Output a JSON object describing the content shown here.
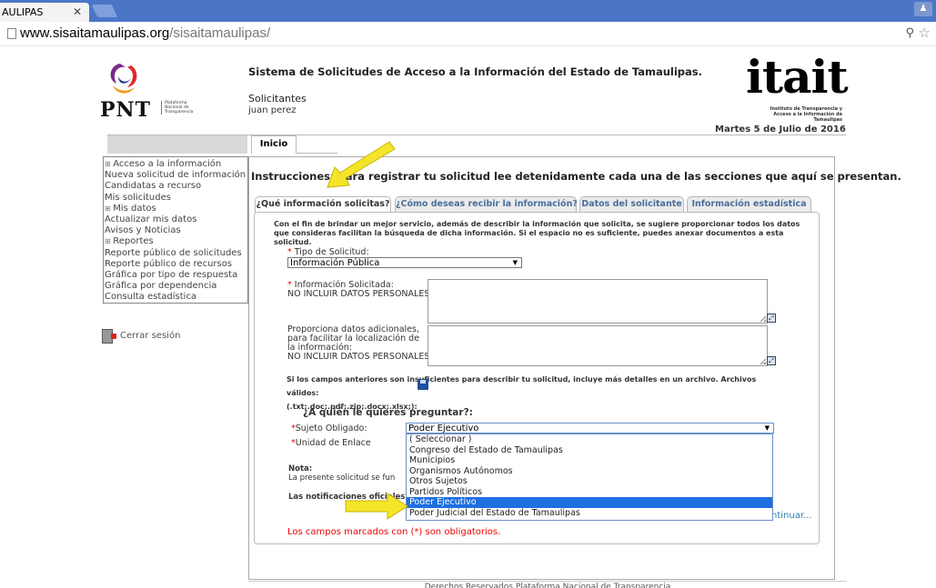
{
  "browser": {
    "tab_title": "AULIPAS",
    "tab_close": "✕",
    "url_host": "www.sisaitamaulipas.org",
    "url_path": "/sisaitamaulipas/"
  },
  "header": {
    "pnt_logo": "PNT",
    "pnt_subtitle": "Plataforma Nacional de Transparencia",
    "system_title": "Sistema de Solicitudes de Acceso a la Información del Estado de Tamaulipas.",
    "role": "Solicitantes",
    "user": "juan perez",
    "itait_logo": "itait",
    "itait_subtitle": "Instituto de Transparencia y Acceso a la Información de Tamaulipas",
    "date": "Martes 5 de Julio de 2016",
    "home_tab": "Inicio"
  },
  "sidebar": {
    "items": [
      {
        "label": "Acceso a la información",
        "section": true
      },
      {
        "label": "Nueva solicitud de información",
        "section": false
      },
      {
        "label": "Candidatas a recurso",
        "section": false
      },
      {
        "label": "Mis solicitudes",
        "section": false
      },
      {
        "label": "Mis datos",
        "section": true
      },
      {
        "label": "Actualizar mis datos",
        "section": false
      },
      {
        "label": "Avisos y Noticias",
        "section": false
      },
      {
        "label": "Reportes",
        "section": true
      },
      {
        "label": "Reporte público de solicitudes",
        "section": false
      },
      {
        "label": "Reporte público de recursos",
        "section": false
      },
      {
        "label": "Gráfica por tipo de respuesta",
        "section": false
      },
      {
        "label": "Gráfica por dependencia",
        "section": false
      },
      {
        "label": "Consulta estadística",
        "section": false
      }
    ],
    "logout": "Cerrar sesión"
  },
  "main": {
    "instructions": "Instrucciones: Para registrar tu solicitud lee detenidamente cada una de las secciones que aquí se presentan.",
    "tabs": [
      {
        "label": "¿Qué información solicitas?",
        "active": true
      },
      {
        "label": "¿Cómo deseas recibir la información?",
        "active": false
      },
      {
        "label": "Datos del solicitante",
        "active": false
      },
      {
        "label": "Información estadística",
        "active": false
      }
    ],
    "intro": "Con el fin de brindar un mejor servicio, además de describir la información que solicita, se sugiere proporcionar todos los datos que consideras facilitan la búsqueda de dicha información. Si el espacio no es suficiente, puedes anexar documentos a esta solicitud.",
    "tipo_label": "Tipo de Solicitud:",
    "tipo_value": "Información Pública",
    "info_label": "Información Solicitada:",
    "info_note": "NO INCLUIR DATOS PERSONALES",
    "extra_label": "Proporciona datos adicionales, para facilitar la localización de la información:",
    "extra_note": "NO INCLUIR DATOS PERSONALES",
    "files_note_1": "Si los campos anteriores son insuficientes para describir tu solicitud, incluye más detalles en un archivo. Archivos válidos:",
    "files_note_2": "(.txt;.doc;.pdf;.zip;.docx;.xlsx;):",
    "ask_heading": "¿A quién le quieres preguntar?:",
    "sujeto_label": "Sujeto Obligado:",
    "sujeto_value": "Poder Ejecutivo",
    "unidad_label": "Unidad de Enlace",
    "nota_heading": "Nota:",
    "nota_text": "La presente solicitud se fun",
    "notif_text": "Las notificaciones oficiales",
    "continue_link": "ntinuar...",
    "mandatory": "Los campos marcados con (*) son obligatorios.",
    "required_mark": "*",
    "dropdown_options": [
      {
        "label": "( Seleccionar )",
        "selected": false
      },
      {
        "label": "Congreso del Estado de Tamaulipas",
        "selected": false
      },
      {
        "label": "Municipios",
        "selected": false
      },
      {
        "label": "Organismos Autónomos",
        "selected": false
      },
      {
        "label": "Otros Sujetos",
        "selected": false
      },
      {
        "label": "Partidos Políticos",
        "selected": false
      },
      {
        "label": "Poder Ejecutivo",
        "selected": true
      },
      {
        "label": "Poder Judicial del Estado de Tamaulipas",
        "selected": false
      }
    ]
  },
  "footer": "Derechos Reservados Plataforma Nacional de Transparencia",
  "colors": {
    "tabstrip": "#4b76c8",
    "accent_link": "#2a7fb0",
    "required": "#e00000",
    "selection": "#1e6fe0",
    "arrow": "#f5e52a"
  },
  "icons": [
    "page-icon",
    "close-icon",
    "extension-icon",
    "star-icon",
    "logout-icon",
    "expand-icon",
    "floppy-icon"
  ]
}
